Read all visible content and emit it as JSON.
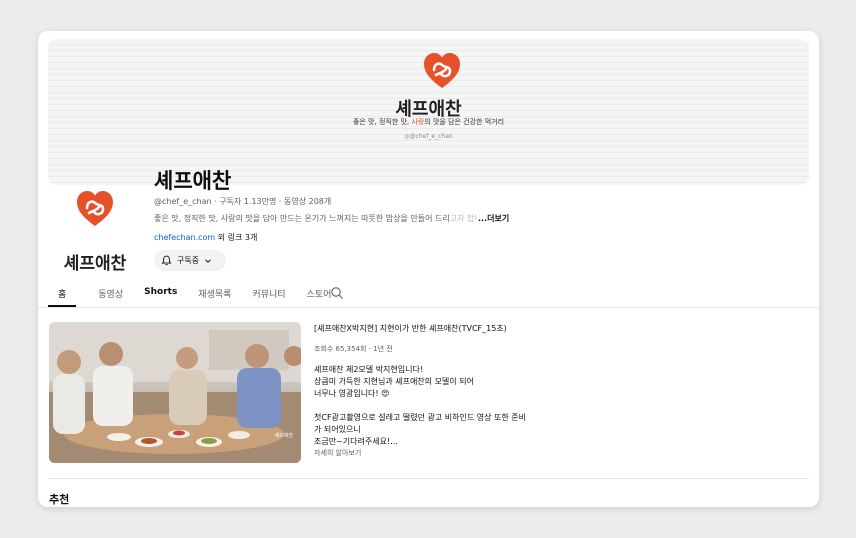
{
  "banner": {
    "name": "셰프애찬",
    "tagline_pre": "좋은 맛, 정직한 맛, ",
    "tagline_highlight": "사랑",
    "tagline_post": "의 맛을 담은 건강한 먹거리",
    "instagram": "@chef_e_chan"
  },
  "channel": {
    "avatar_name": "셰프애찬",
    "title": "셰프애찬",
    "meta": "@chef_e_chan · 구독자 1.13만명 · 동영상 208개",
    "description": "좋은 맛, 정직한 맛, 사랑의 맛을 담아 만드는 온기가 느껴지는 따뜻한 밥상을 만들어 드리",
    "description_fade": "고자 합니다",
    "more_label": "...더보기",
    "link_url": "chefechan.com",
    "link_extra": " 외 링크 3개",
    "subscribe_label": "구독중"
  },
  "tabs": [
    {
      "label": "홈"
    },
    {
      "label": "동영상"
    },
    {
      "label": "Shorts"
    },
    {
      "label": "재생목록"
    },
    {
      "label": "커뮤니티"
    },
    {
      "label": "스토어"
    }
  ],
  "featured_video": {
    "title": "[셰프애찬X박지현] 지현이가 반한 셰프애찬(TVCF_15초)",
    "meta": "조회수 65,354회 · 1년 전",
    "description_lines": [
      "셰프애찬 제2모델 박지현입니다!",
      "상큼미 가득한 지현님과 셰프애찬의 모델이 되어",
      "너무나 영광입니다! 😍",
      "",
      "첫CF광고촬영으로 설레고 떨렸던 광고 비하인드 영상 또한 준비",
      "가 되어있으니",
      "조금만~기다려주세요!..."
    ],
    "more_label": "자세히 알아보기",
    "watermark": "셰프애찬"
  },
  "section": {
    "title": "추천"
  },
  "colors": {
    "brand": "#e6512a",
    "link": "#065fd4"
  }
}
